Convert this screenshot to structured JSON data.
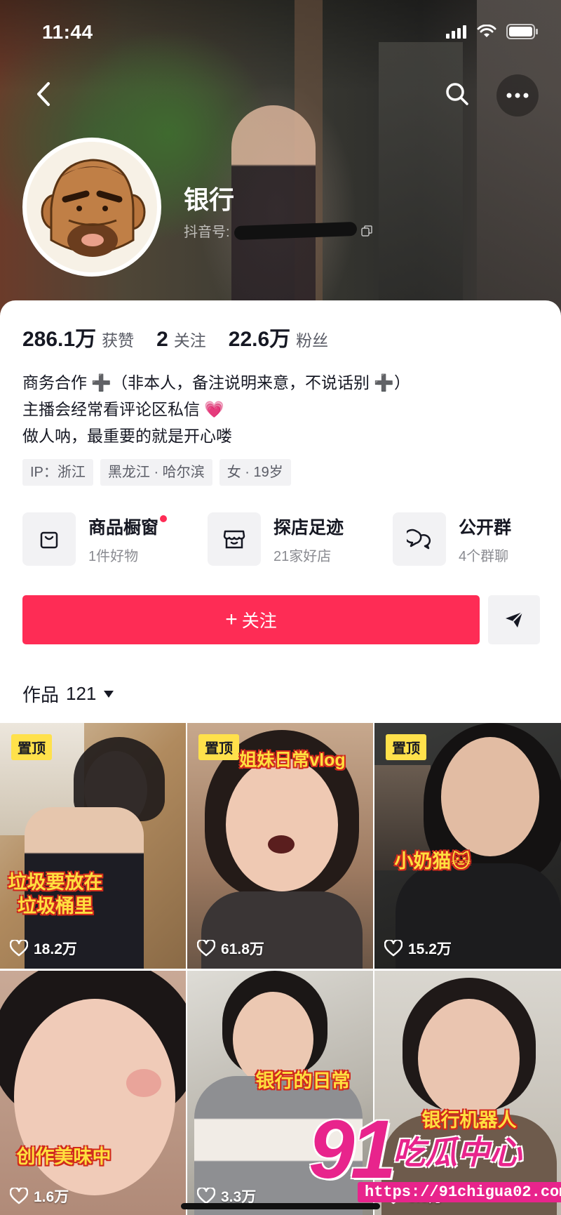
{
  "status_bar": {
    "time": "11:44"
  },
  "profile": {
    "name": "银行",
    "id_prefix": "抖音号:",
    "stats": [
      {
        "value": "286.1万",
        "label": "获赞"
      },
      {
        "value": "2",
        "label": "关注"
      },
      {
        "value": "22.6万",
        "label": "粉丝"
      }
    ],
    "bio": [
      "商务合作 ➕（非本人，备注说明来意，不说话别 ➕）",
      "主播会经常看评论区私信",
      "做人呐，最重要的就是开心喽"
    ],
    "bio_emoji": "💗",
    "tags": [
      "IP：浙江",
      "黑龙江 · 哈尔滨",
      "女 · 19岁"
    ]
  },
  "shortcuts": [
    {
      "title": "商品橱窗",
      "subtitle": "1件好物",
      "icon": "bag-icon",
      "has_dot": true
    },
    {
      "title": "探店足迹",
      "subtitle": "21家好店",
      "icon": "store-icon",
      "has_dot": false
    },
    {
      "title": "公开群",
      "subtitle": "4个群聊",
      "icon": "chat-bubbles-icon",
      "has_dot": false
    }
  ],
  "actions": {
    "follow_label": "关注",
    "follow_plus": "+"
  },
  "works": {
    "label": "作品",
    "count": "121"
  },
  "videos": [
    {
      "pinned": true,
      "pin_label": "置顶",
      "caption": "垃圾要放在垃圾桶里",
      "likes": "18.2万"
    },
    {
      "pinned": true,
      "pin_label": "置顶",
      "caption": "姐妹日常vlog",
      "likes": "61.8万"
    },
    {
      "pinned": true,
      "pin_label": "置顶",
      "caption": "小奶猫🐱",
      "likes": "15.2万"
    },
    {
      "pinned": false,
      "caption": "创作美味中",
      "likes": "1.6万"
    },
    {
      "pinned": false,
      "caption": "银行的日常",
      "likes": "3.3万"
    },
    {
      "pinned": false,
      "caption": "银行机器人",
      "likes": "3.3万"
    }
  ],
  "watermark": {
    "number": "91",
    "text": "吃瓜中心",
    "url": "https://91chigua02.com"
  },
  "colors": {
    "accent": "#fe2c55",
    "pin": "#ffe14b",
    "watermark": "#e8248c"
  }
}
